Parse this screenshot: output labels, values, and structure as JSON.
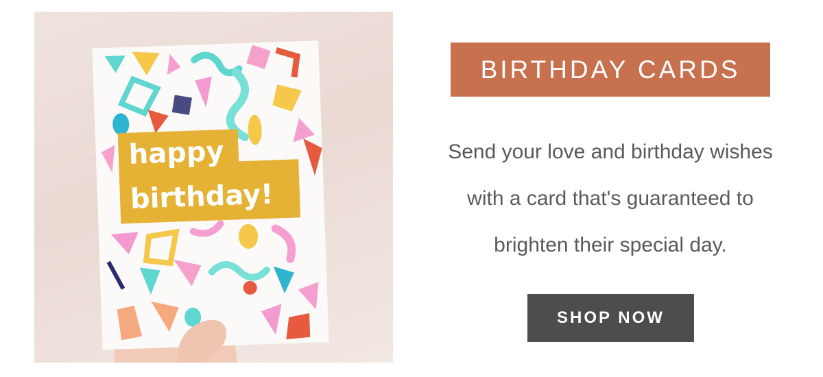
{
  "hero": {
    "card_text": [
      "happy",
      "birthday!"
    ],
    "card_label_color": "#e5b235"
  },
  "promo": {
    "badge_label": "BIRTHDAY CARDS",
    "badge_color": "#c8714e",
    "description_lines": [
      "Send your love and birthday wishes",
      "with a card that's guaranteed to",
      "brighten their special day."
    ],
    "cta_label": "SHOP NOW",
    "cta_color": "#4d4d4f"
  }
}
